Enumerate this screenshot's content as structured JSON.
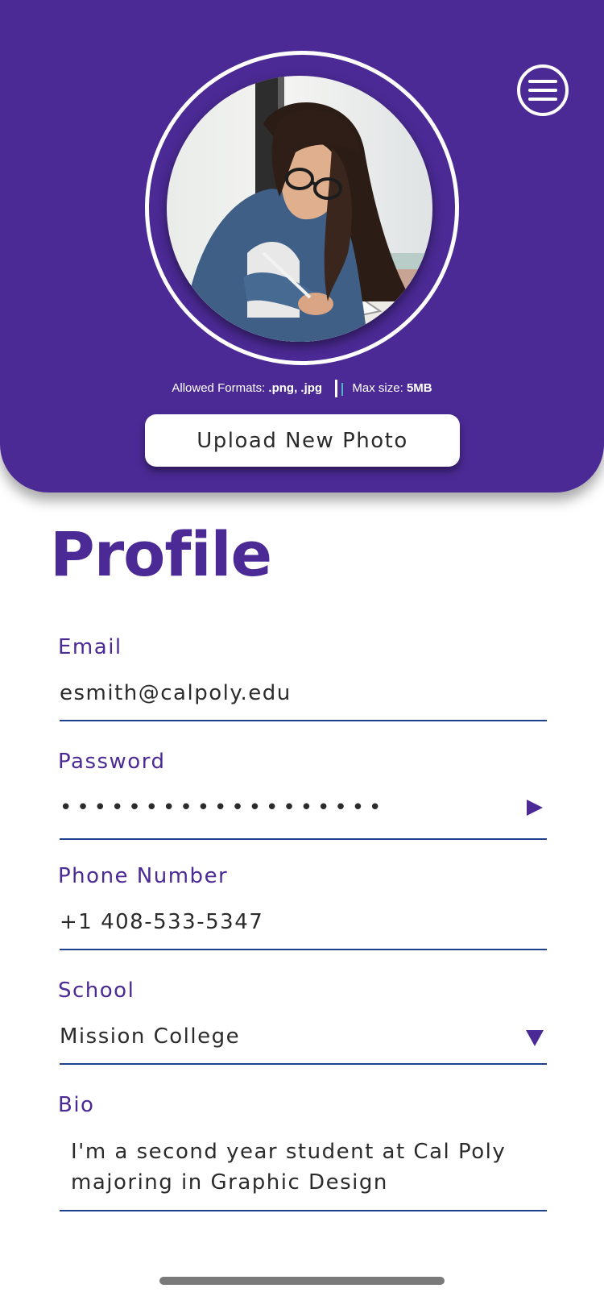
{
  "header": {
    "background_color": "#4b2a95",
    "menu_icon": "hamburger-menu-icon",
    "avatar_description_icon": "profile-photo",
    "formats_label": "Allowed Formats:",
    "formats_value": ".png, .jpg",
    "max_size_label": "Max size:",
    "max_size_value": "5MB",
    "upload_button_label": "Upload New Photo"
  },
  "page": {
    "title": "Profile",
    "accent_color": "#4b2a95",
    "line_color": "#1f3f8f"
  },
  "fields": {
    "email": {
      "label": "Email",
      "value": "esmith@calpoly.edu"
    },
    "password": {
      "label": "Password",
      "value": "•••••••••••••••••••",
      "icon": "play-triangle-icon"
    },
    "phone": {
      "label": "Phone Number",
      "value": "+1 408-533-5347"
    },
    "school": {
      "label": "School",
      "value": "Mission College",
      "icon": "chevron-down-icon"
    },
    "bio": {
      "label": "Bio",
      "value": "I'm a second year student at Cal Poly majoring in Graphic Design"
    }
  }
}
